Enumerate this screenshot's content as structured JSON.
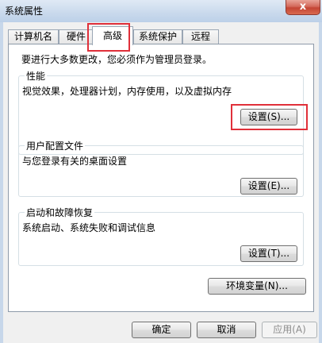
{
  "window": {
    "title": "系统属性",
    "close_glyph": "x"
  },
  "tabs": [
    {
      "label": "计算机名"
    },
    {
      "label": "硬件"
    },
    {
      "label": "高级",
      "active": true
    },
    {
      "label": "系统保护"
    },
    {
      "label": "远程"
    }
  ],
  "admin_note": "要进行大多数更改，您必须作为管理员登录。",
  "groups": {
    "performance": {
      "title": "性能",
      "description": "视觉效果，处理器计划，内存使用，以及虚拟内存",
      "button": "设置(S)..."
    },
    "user_profiles": {
      "title": "用户配置文件",
      "description": "与您登录有关的桌面设置",
      "button": "设置(E)..."
    },
    "startup_recovery": {
      "title": "启动和故障恢复",
      "description": "系统启动、系统失败和调试信息",
      "button": "设置(T)..."
    }
  },
  "env_button": "环境变量(N)...",
  "footer": {
    "ok": "确定",
    "cancel": "取消",
    "apply": "应用(A)"
  },
  "colors": {
    "highlight": "#e0303a",
    "title_bar": "#c9d9ec",
    "close_button": "#c44535"
  }
}
